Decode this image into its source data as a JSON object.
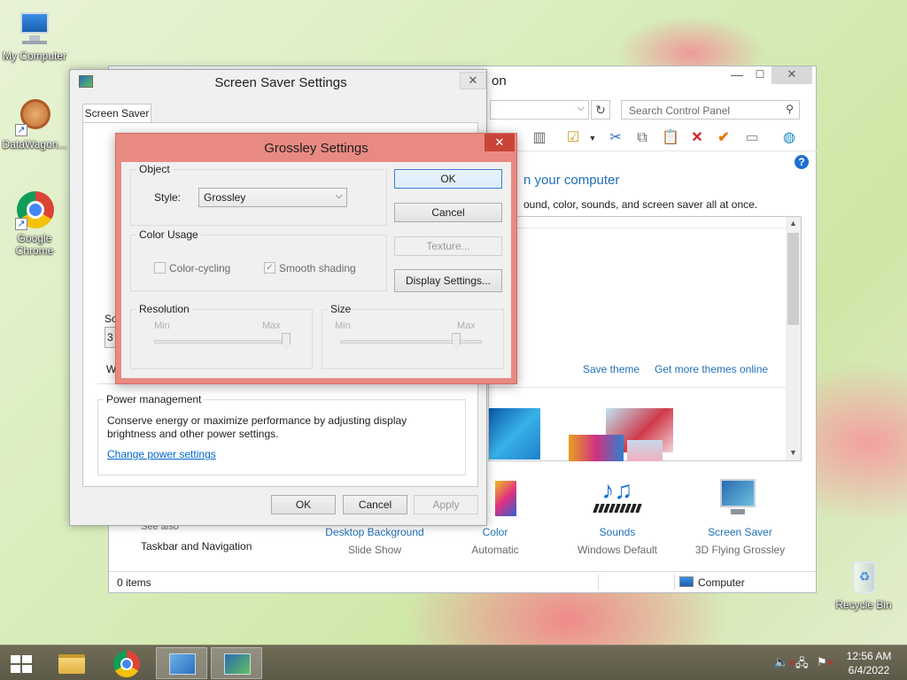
{
  "desktop": {
    "icons": [
      {
        "label": "My Computer"
      },
      {
        "label": "DataWagon..."
      },
      {
        "label": "Google Chrome"
      },
      {
        "label": "Recycle Bin"
      }
    ]
  },
  "control_panel": {
    "title_fragment": "on",
    "search_placeholder": "Search Control Panel",
    "heading_fragment": "n your computer",
    "description_fragment": "ound, color, sounds, and screen saver all at once.",
    "save_theme": "Save theme",
    "more_themes": "Get more themes online",
    "see_also": "See also",
    "taskbar_nav": "Taskbar and Navigation",
    "bottom_items": [
      {
        "title": "Desktop Background",
        "subtitle": "Slide Show"
      },
      {
        "title": "Color",
        "subtitle": "Automatic"
      },
      {
        "title": "Sounds",
        "subtitle": "Windows Default"
      },
      {
        "title": "Screen Saver",
        "subtitle": "3D Flying Grossley"
      }
    ],
    "status_items": "0 items",
    "status_computer": "Computer"
  },
  "screensaver_dialog": {
    "title": "Screen Saver Settings",
    "tab": "Screen Saver",
    "partial_label": "Sc",
    "partial_field": "3",
    "partial_text": "W",
    "power_title": "Power management",
    "power_text1": "Conserve energy or maximize performance by adjusting display",
    "power_text2": "brightness and other power settings.",
    "power_link": "Change power settings",
    "ok": "OK",
    "cancel": "Cancel",
    "apply": "Apply"
  },
  "grossley_dialog": {
    "title": "Grossley Settings",
    "object_group": "Object",
    "style_label": "Style:",
    "style_value": "Grossley",
    "color_group": "Color Usage",
    "color_cycling": "Color-cycling",
    "color_cycling_checked": false,
    "smooth_shading": "Smooth shading",
    "smooth_shading_checked": true,
    "resolution_group": "Resolution",
    "size_group": "Size",
    "min": "Min",
    "max": "Max",
    "resolution_level": 1.0,
    "size_level": 0.82,
    "ok": "OK",
    "cancel": "Cancel",
    "texture": "Texture...",
    "display_settings": "Display Settings..."
  },
  "taskbar": {
    "time": "12:56 AM",
    "date": "6/4/2022"
  }
}
